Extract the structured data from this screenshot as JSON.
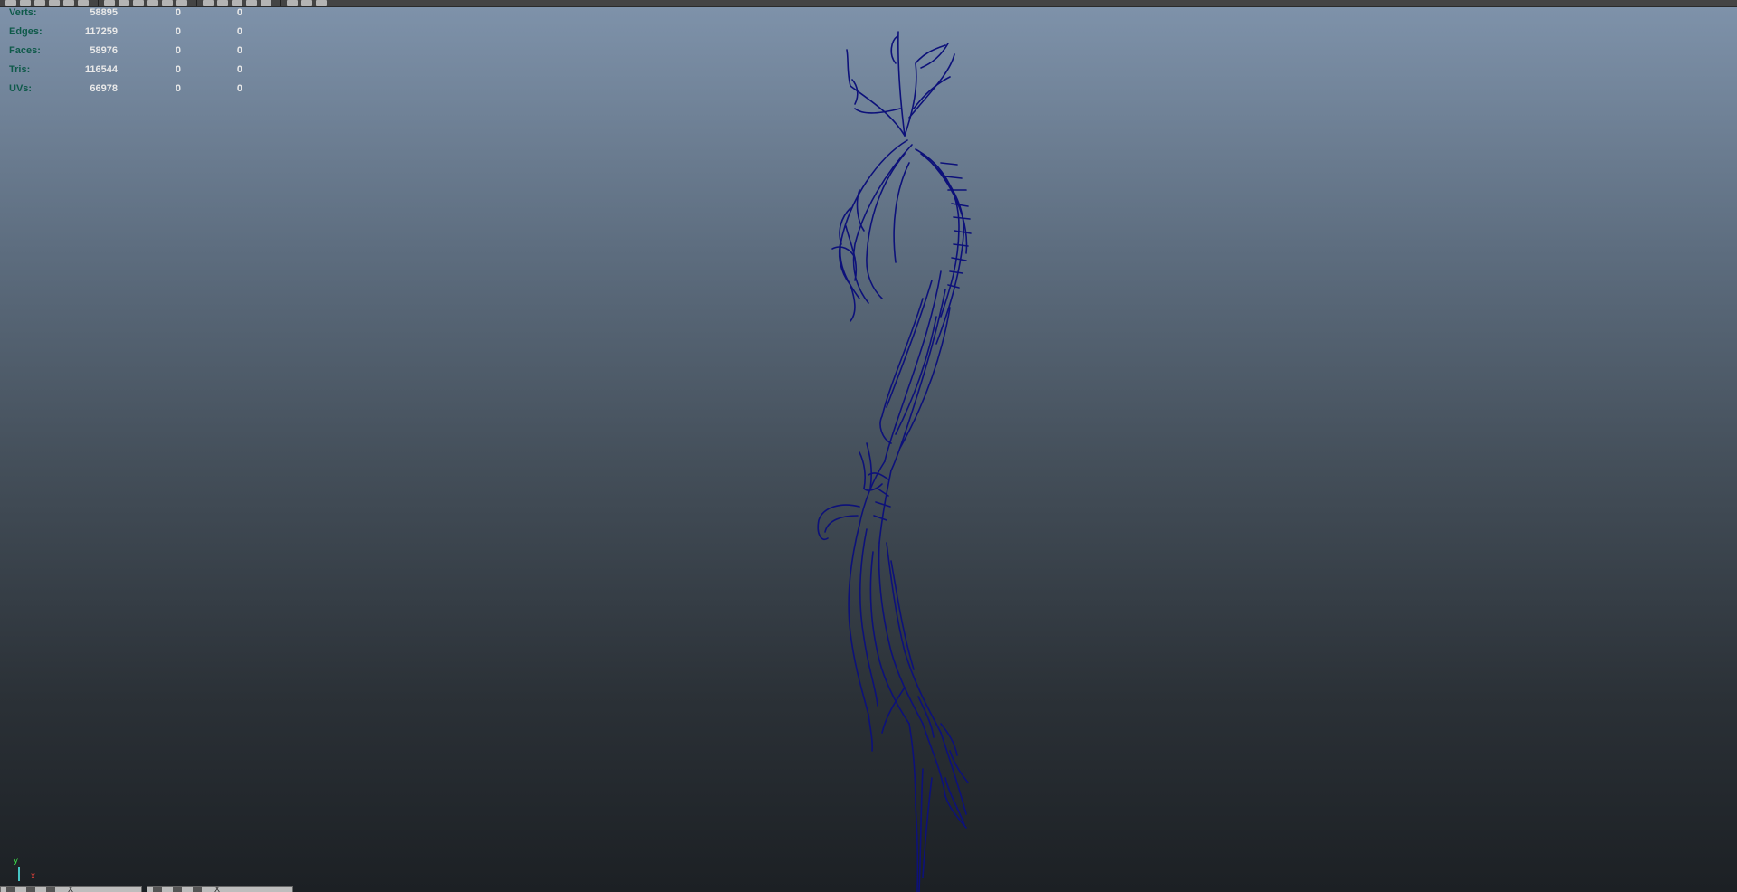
{
  "toolbar": {
    "icons": [
      "render-icon",
      "save-icon",
      "open-icon",
      "snap-icon",
      "magnet-icon",
      "camera-icon",
      "grid-icon",
      "wireframe-icon",
      "shaded-icon",
      "texture-icon",
      "light-icon",
      "shadow-icon",
      "sphere-icon",
      "teapot-icon",
      "cube-icon",
      "isolate-icon",
      "xray-icon",
      "resolution-icon",
      "frame-icon",
      "gate-icon"
    ]
  },
  "heads_up": {
    "rows": [
      {
        "label": "Verts:",
        "v1": "58895",
        "v2": "0",
        "v3": "0"
      },
      {
        "label": "Edges:",
        "v1": "117259",
        "v2": "0",
        "v3": "0"
      },
      {
        "label": "Faces:",
        "v1": "58976",
        "v2": "0",
        "v3": "0"
      },
      {
        "label": "Tris:",
        "v1": "116544",
        "v2": "0",
        "v3": "0"
      },
      {
        "label": "UVs:",
        "v1": "66978",
        "v2": "0",
        "v3": "0"
      }
    ]
  },
  "axis": {
    "y": "y",
    "x": "x"
  },
  "shelf": {
    "close_1": "X",
    "close_2": "X"
  },
  "colors": {
    "model_stroke": "#0d117a",
    "stat_label": "#0f5a4a",
    "stat_value": "#e9e9e9"
  }
}
